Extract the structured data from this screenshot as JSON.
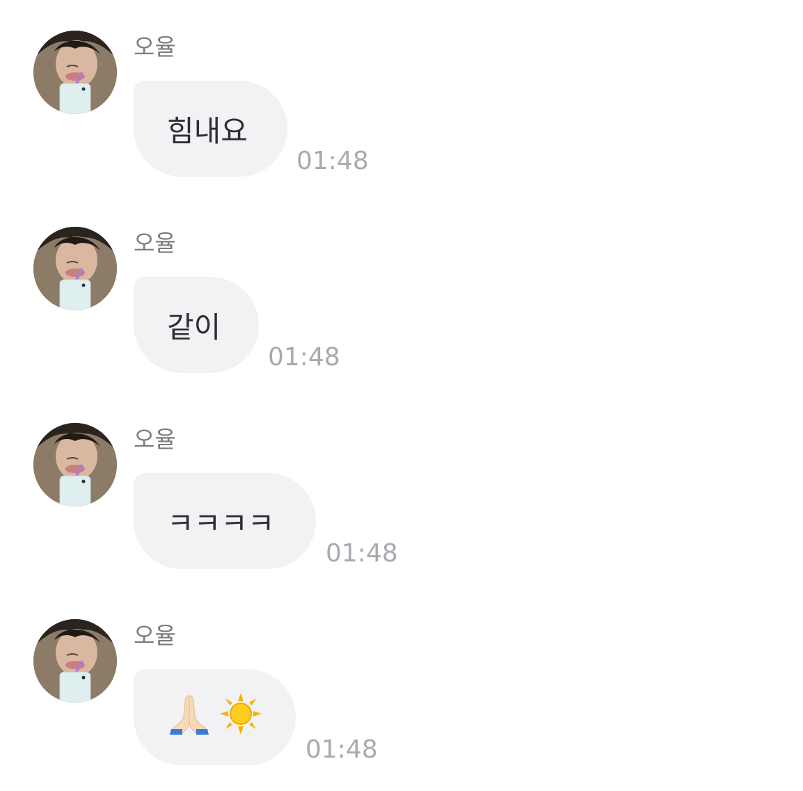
{
  "messages": [
    {
      "sender": "오율",
      "text": "힘내요",
      "time": "01:48"
    },
    {
      "sender": "오율",
      "text": "같이",
      "time": "01:48"
    },
    {
      "sender": "오율",
      "text": "ㅋㅋㅋㅋ",
      "time": "01:48"
    },
    {
      "sender": "오율",
      "text": "",
      "emoji": [
        "folded-hands",
        "sun"
      ],
      "time": "01:48"
    }
  ],
  "colors": {
    "bubble": "#f2f2f5",
    "sender": "#7b7b80",
    "time": "#a9a9b0",
    "text": "#2e2e33"
  }
}
